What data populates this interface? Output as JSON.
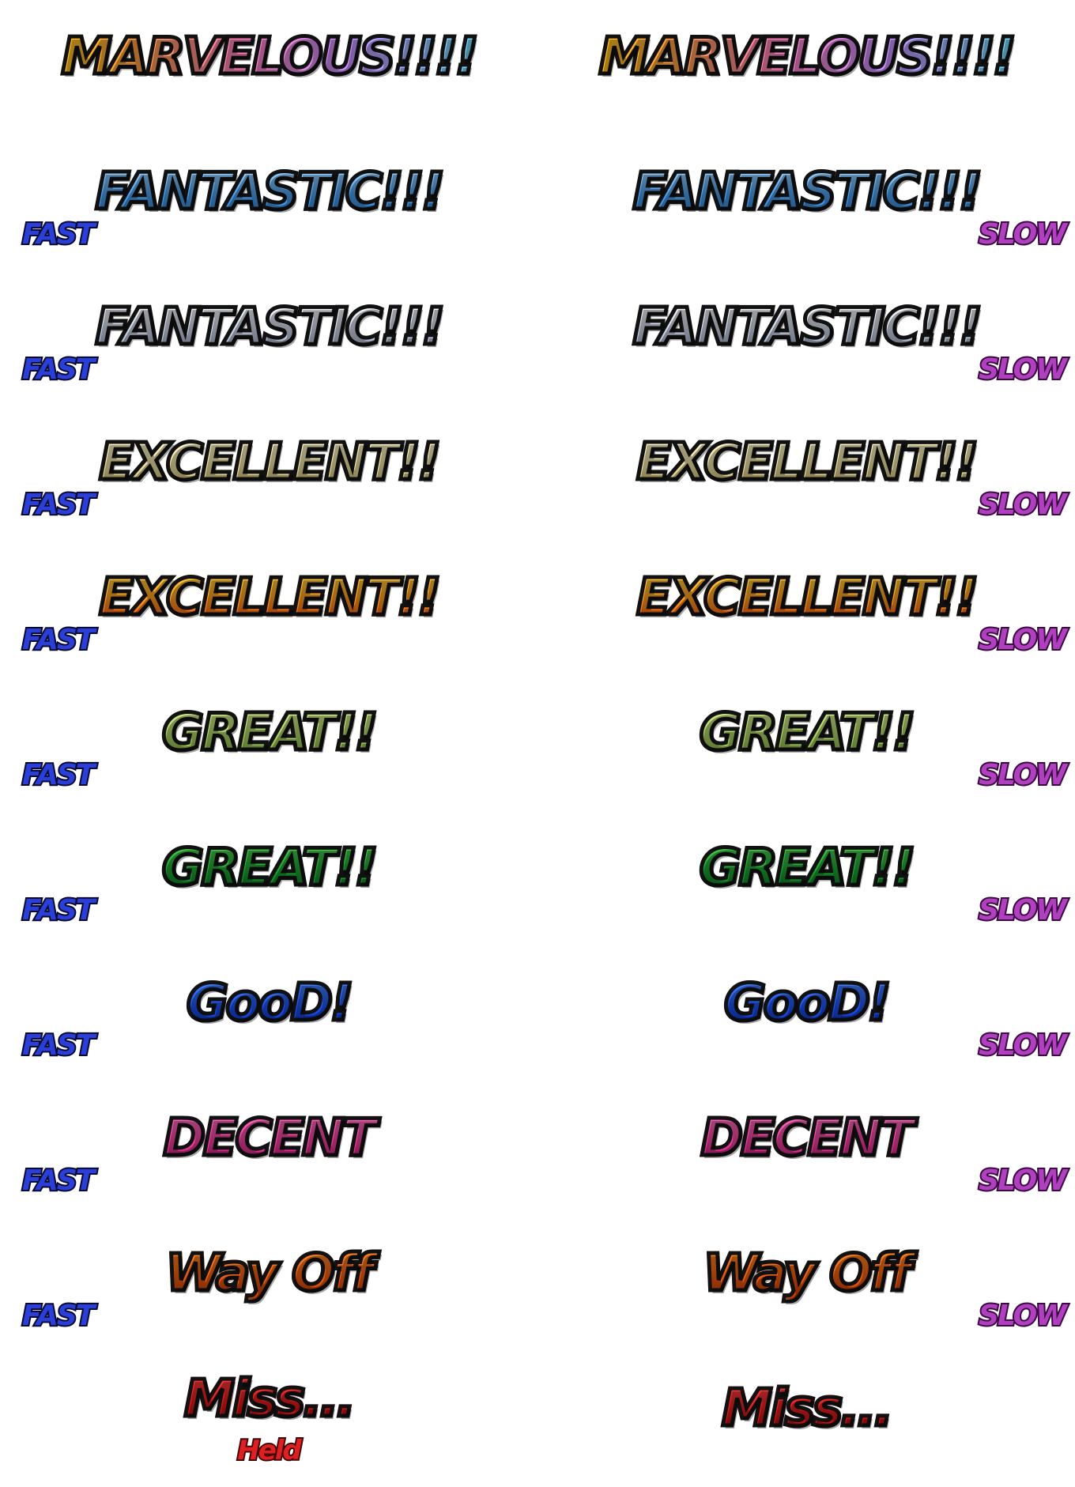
{
  "judgments": [
    {
      "label": "MARVELOUS!!!!",
      "style": "marv",
      "timing": false
    },
    {
      "label": "FANTASTIC!!!",
      "style": "fant-blue",
      "timing": true
    },
    {
      "label": "FANTASTIC!!!",
      "style": "fant-white",
      "timing": true
    },
    {
      "label": "EXCELLENT!!",
      "style": "exc-pale",
      "timing": true
    },
    {
      "label": "EXCELLENT!!",
      "style": "exc-gold",
      "timing": true
    },
    {
      "label": "GREAT!!",
      "style": "great-lime",
      "timing": true
    },
    {
      "label": "GREAT!!",
      "style": "great-green",
      "timing": true
    },
    {
      "label": "GooD!",
      "style": "good",
      "timing": true
    },
    {
      "label": "DECENT",
      "style": "decent",
      "timing": true
    },
    {
      "label": "Way Off",
      "style": "wayoff",
      "timing": true
    },
    {
      "label": "Miss...",
      "style": "miss",
      "timing": false
    }
  ],
  "tags": {
    "fast": "FAST",
    "slow": "SLOW",
    "held": "Held"
  },
  "colors": {
    "fast": "#2a3fd8",
    "slow": "#b040c0",
    "held": "#e02020",
    "outline": "#111111"
  }
}
